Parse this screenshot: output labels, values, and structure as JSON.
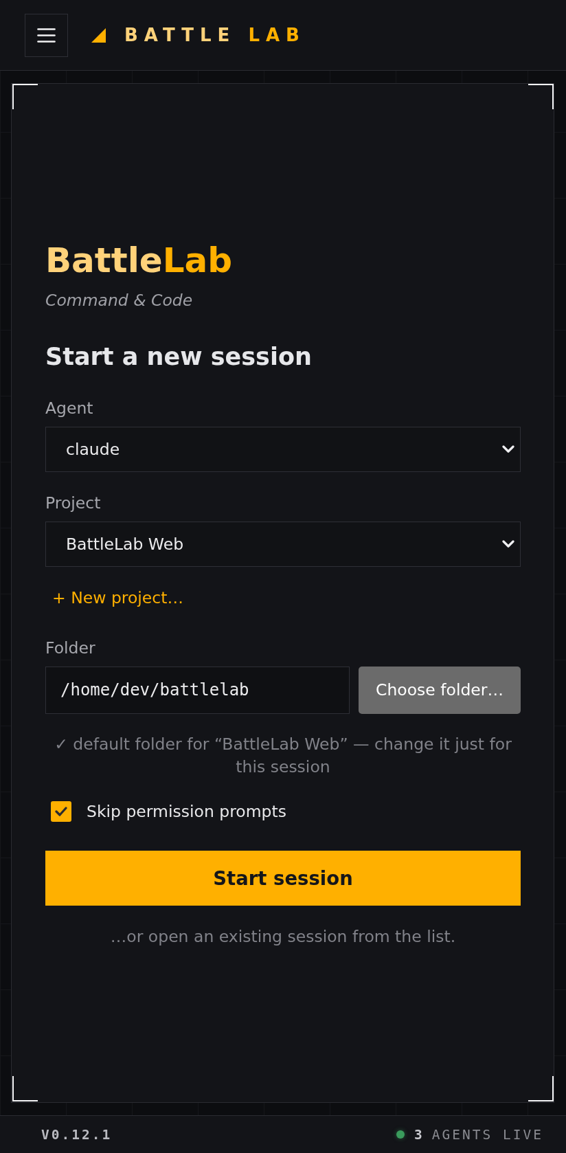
{
  "header": {
    "brand": [
      {
        "text": "BATTLE",
        "color": "#ffd27a"
      },
      {
        "text": "LAB",
        "color": "#ffb000"
      }
    ]
  },
  "card": {
    "title": [
      {
        "text": "Battle",
        "color": "#ffd27a"
      },
      {
        "text": "Lab",
        "color": "#ffb000"
      }
    ],
    "subtitle": "Command & Code",
    "heading": "Start a new session",
    "fields": [
      {
        "kind": "select",
        "label": "Agent",
        "value": "claude"
      },
      {
        "kind": "select",
        "label": "Project",
        "value": "BattleLab Web"
      },
      {
        "kind": "link",
        "text": "+ New project…"
      },
      {
        "kind": "folder",
        "label": "Folder",
        "value": "/home/dev/battlelab",
        "button": "Choose folder…",
        "hint": "✓ default folder for “BattleLab Web” — change it just for this session"
      },
      {
        "kind": "checkbox",
        "label": "Skip permission prompts",
        "checked": true
      }
    ],
    "submit": "Start session",
    "footnote": "…or open an existing session from the list."
  },
  "footer": {
    "version": "V0.12.1",
    "agents_count": "3",
    "agents_label": "AGENTS LIVE"
  }
}
